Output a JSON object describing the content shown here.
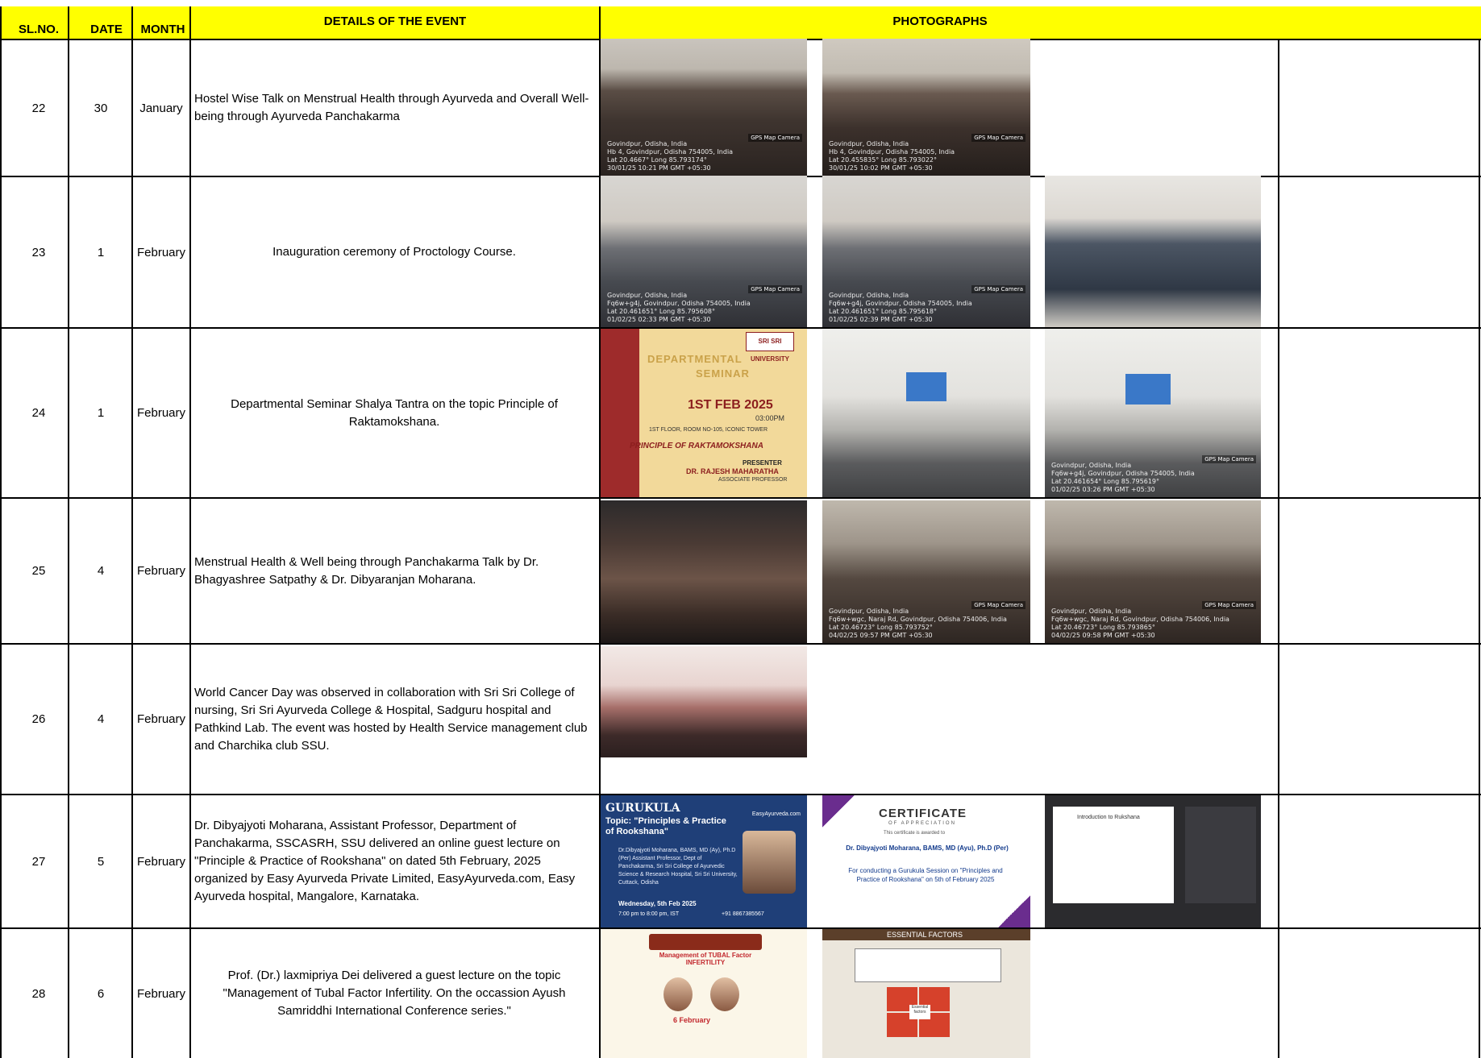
{
  "header": {
    "sl_no": "SL.NO.",
    "date": "DATE",
    "month": "MONTH",
    "details": "DETAILS OF THE EVENT",
    "photographs": "PHOTOGRAPHS"
  },
  "colors": {
    "header_fill": "#ffff00",
    "grid": "#000000"
  },
  "rows": [
    {
      "sl_no": "22",
      "date": "30",
      "month": "January",
      "details": "Hostel Wise Talk on Menstrual Health through Ayurveda and Overall Well-being through Ayurveda Panchakarma",
      "photos": [
        {
          "kind": "hall-photo",
          "stamp": "Govindpur, Odisha, India\nHb 4, Govindpur, Odisha 754005, India\nLat 20.4667° Long 85.793174°\n30/01/25 10:21 PM GMT +05:30",
          "gps": "GPS Map Camera"
        },
        {
          "kind": "hall-photo",
          "stamp": "Govindpur, Odisha, India\nHb 4, Govindpur, Odisha 754005, India\nLat 20.455835° Long 85.793022°\n30/01/25 10:02 PM GMT +05:30",
          "gps": "GPS Map Camera"
        }
      ]
    },
    {
      "sl_no": "23",
      "date": "1",
      "month": "February",
      "details": "Inauguration ceremony of Proctology Course.",
      "photos": [
        {
          "kind": "conference-photo",
          "stamp": "Govindpur, Odisha, India\nFq6w+g4j, Govindpur, Odisha 754005, India\nLat 20.461651° Long 85.795608°\n01/02/25 02:33 PM GMT +05:30",
          "gps": "GPS Map Camera"
        },
        {
          "kind": "conference-photo",
          "stamp": "Govindpur, Odisha, India\nFq6w+g4j, Govindpur, Odisha 754005, India\nLat 20.461651° Long 85.795618°\n01/02/25 02:39 PM GMT +05:30",
          "gps": "GPS Map Camera"
        },
        {
          "kind": "group-photo",
          "stamp": "",
          "gps": ""
        }
      ]
    },
    {
      "sl_no": "24",
      "date": "1",
      "month": "February",
      "details": "Departmental Seminar Shalya Tantra on the topic Principle of Raktamokshana.",
      "seminar_poster": {
        "logo": "SRI SRI UNIVERSITY",
        "line1": "DEPARTMENTAL",
        "line2": "SEMINAR",
        "date": "1ST FEB 2025",
        "time": "03:00PM",
        "venue": "1ST FLOOR, ROOM NO-105, ICONIC TOWER",
        "topic": "PRINCIPLE OF RAKTAMOKSHANA",
        "presenter_label": "PRESENTER",
        "presenter": "DR. RAJESH MAHARATHA",
        "role": "ASSOCIATE PROFESSOR"
      },
      "photos": [
        {
          "kind": "classroom-photo",
          "stamp": "",
          "gps": ""
        },
        {
          "kind": "classroom-photo",
          "stamp": "Govindpur, Odisha, India\nFq6w+g4j, Govindpur, Odisha 754005, India\nLat 20.461654° Long 85.795619°\n01/02/25 03:26 PM GMT +05:30",
          "gps": "GPS Map Camera"
        }
      ]
    },
    {
      "sl_no": "25",
      "date": "4",
      "month": "February",
      "details": "Menstrual Health & Well being through Panchakarma Talk by Dr. Bhagyashree Satpathy & Dr. Dibyaranjan Moharana.",
      "photos": [
        {
          "kind": "night-photo",
          "stamp": "",
          "gps": ""
        },
        {
          "kind": "room-photo",
          "stamp": "Govindpur, Odisha, India\nFq6w+wgc, Naraj Rd, Govindpur, Odisha 754006, India\nLat 20.46723° Long 85.793752°\n04/02/25 09:57 PM GMT +05:30",
          "gps": "GPS Map Camera"
        },
        {
          "kind": "room-photo",
          "stamp": "Govindpur, Odisha, India\nFq6w+wgc, Naraj Rd, Govindpur, Odisha 754006, India\nLat 20.46723° Long 85.793865°\n04/02/25 09:58 PM GMT +05:30",
          "gps": "GPS Map Camera"
        }
      ]
    },
    {
      "sl_no": "26",
      "date": "4",
      "month": "February",
      "details": "World Cancer Day was observed in collaboration with Sri Sri College of nursing, Sri Sri Ayurveda College & Hospital, Sadguru hospital and Pathkind Lab. The event was hosted by Health Service management club and Charchika club SSU.",
      "photos": [
        {
          "kind": "stage-photo",
          "stamp": "",
          "gps": ""
        }
      ]
    },
    {
      "sl_no": "27",
      "date": "5",
      "month": "February",
      "details": "Dr. Dibyajyoti Moharana, Assistant Professor, Department of Panchakarma, SSCASRH, SSU delivered an online guest lecture on \"Principle & Practice of Rookshana\" on dated 5th February, 2025 organized by Easy Ayurveda Private Limited, EasyAyurveda.com, Easy Ayurveda hospital, Mangalore, Karnataka.",
      "gurukula_poster": {
        "title": "GURUKULA",
        "brand": "EasyAyurveda.com",
        "topic": "Topic: \"Principles & Practice of Rookshana\"",
        "speaker": "Dr.Dibyajyoti Moharana, BAMS, MD (Ay), Ph.D (Per) Assistant Professor, Dept of Panchakarma, Sri Sri College of Ayurvedic Science & Research Hospital, Sri Sri University, Cuttack, Odisha",
        "date": "Wednesday, 5th Feb 2025",
        "time": "7:00 pm to 8:00 pm, IST",
        "phone": "+91 8867385567"
      },
      "certificate": {
        "title": "CERTIFICATE",
        "subtitle": "OF APPRECIATION",
        "awarded": "This certificate is awarded to",
        "name": "Dr. Dibyajyoti Moharana, BAMS, MD (Ayu), Ph.D (Per)",
        "for": "For conducting a Gurukula Session on \"Principles and Practice of Rookshana\" on 5th of February 2025"
      },
      "meeting_doc_title": "Introduction to Rukshana"
    },
    {
      "sl_no": "28",
      "date": "6",
      "month": "February",
      "details": "Prof. (Dr.) laxmipriya Dei  delivered a guest lecture on the topic \"Management of Tubal Factor Infertility. On the occassion Ayush Samriddhi International Conference series.\"",
      "ayush_poster": {
        "title": "Management of TUBAL Factor INFERTILITY",
        "date": "6 February"
      },
      "slide": {
        "title": "ESSENTIAL FACTORS",
        "center": "Essential factors"
      }
    }
  ]
}
